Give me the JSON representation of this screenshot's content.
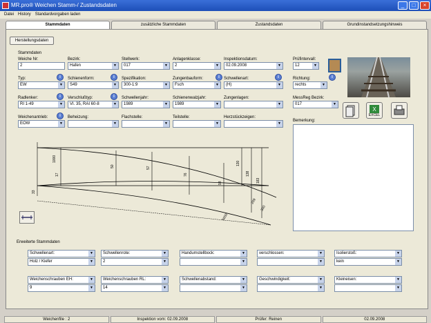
{
  "window": {
    "title": "MR.pro® Weichen Stamm-/ Zustandsdaten"
  },
  "menu": [
    "Datei",
    "History",
    "Standardvorgaben laden"
  ],
  "tabs": [
    "Stammdaten",
    "zusätzliche Stammdaten",
    "Zustandsdaten",
    "Grundinstandsetzungshinweis"
  ],
  "herstellung_button": "Herstellungsdaten",
  "stammdaten": {
    "group_label": "Stammdaten",
    "fields": [
      {
        "label": "Weiche Nr:",
        "value": "2"
      },
      {
        "label": "Bezirk:",
        "value": "Hafen"
      },
      {
        "label": "Stellwerk:",
        "value": "017"
      },
      {
        "label": "Anlagenklasse:",
        "value": "2"
      },
      {
        "label": "Inspektionsdatum:",
        "value": "02.09.2008"
      },
      {
        "label": "Prüfintervall:",
        "value": "12"
      },
      {
        "label": "Typ:",
        "value": "EW"
      },
      {
        "label": "Schienenform:",
        "value": "S49"
      },
      {
        "label": "Spezifikation:",
        "value": "300-1:9"
      },
      {
        "label": "Zungenbauform:",
        "value": "Fsch"
      },
      {
        "label": "Schwellenart:",
        "value": "(H)"
      },
      {
        "label": "Richtung:",
        "value": "rechts"
      },
      {
        "label": "Radlenker:",
        "value": "RI 1-49"
      },
      {
        "label": "Verschlußtyp:",
        "value": "VI. 35, RAI 60-8"
      },
      {
        "label": "Schwellenjahr:",
        "value": "1989"
      },
      {
        "label": "Schienenwalzjahr:",
        "value": "1989"
      },
      {
        "label": "Zungenlagen:",
        "value": ""
      },
      {
        "label": "MessReg Bezirk:",
        "value": "017"
      },
      {
        "label": "Weichenantrieb:",
        "value": "EOW"
      },
      {
        "label": "Beheizung:",
        "value": ""
      },
      {
        "label": "Flachstelle:",
        "value": ""
      },
      {
        "label": "Teilstelle:",
        "value": ""
      },
      {
        "label": "Herzstückzeigen:",
        "value": ""
      }
    ],
    "bemerkung_label": "Bemerkung:"
  },
  "icons": {
    "info": "i",
    "excel_label": "EXCEL"
  },
  "drawing": {
    "labels": [
      "1000",
      "17",
      "33",
      "50",
      "57",
      "76",
      "93",
      "130",
      "138",
      "183",
      "209",
      "300",
      "5000"
    ]
  },
  "erweiterte": {
    "group_label": "Erweiterte Stammdaten",
    "row1": [
      {
        "label": "Schwellenart:",
        "value": "Holz / Kiefer"
      },
      {
        "label": "Schwellenrote:",
        "value": "2"
      },
      {
        "label": "Handumstellbock:",
        "value": ""
      },
      {
        "label": "verschlossen:",
        "value": ""
      },
      {
        "label": "Isolierstoß:",
        "value": "kein"
      }
    ],
    "row2": [
      {
        "label": "Weichenschrauben EH:",
        "value": "9"
      },
      {
        "label": "Weichenschrauben RL:",
        "value": "14"
      },
      {
        "label": "Schwellenabstand:",
        "value": ""
      },
      {
        "label": "Geschwindigkeit:",
        "value": ""
      },
      {
        "label": "Kleineisen:",
        "value": ""
      }
    ]
  },
  "statusbar": [
    "Weichenfile : 2",
    "Inspektion vom: 02.09.2008",
    "Prüfer: Reinen",
    "02.09.2008"
  ]
}
